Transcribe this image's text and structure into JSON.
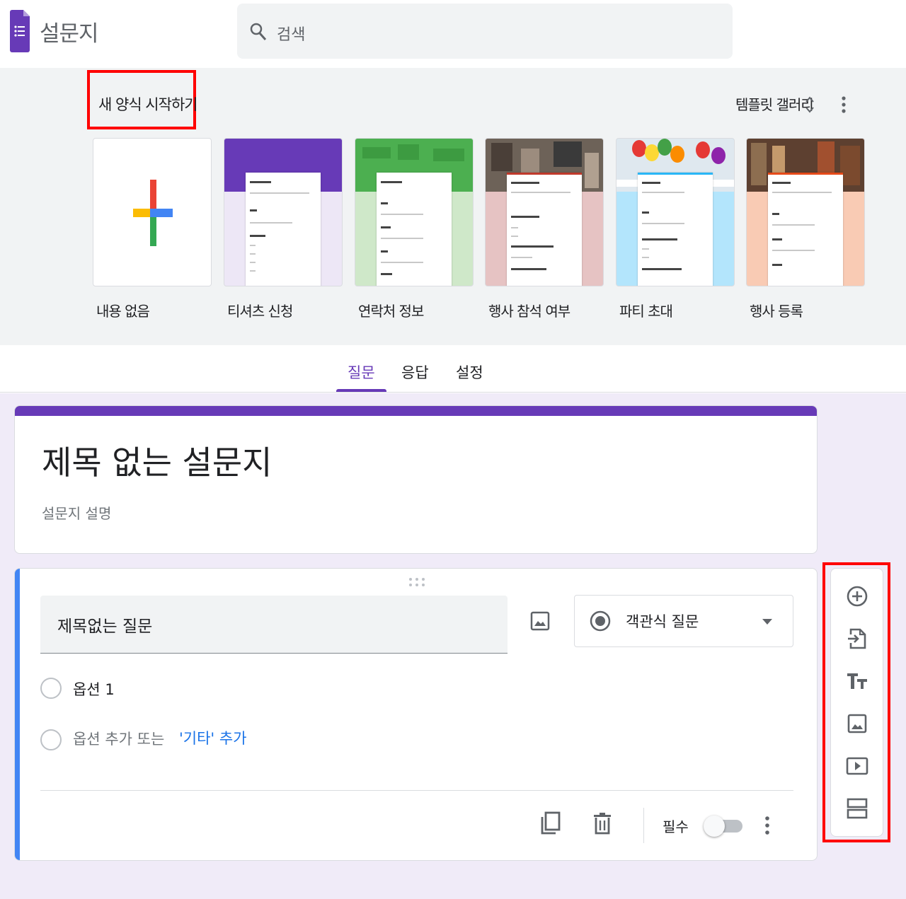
{
  "header": {
    "app_title": "설문지",
    "search_placeholder": "검색"
  },
  "gallery": {
    "start_title": "새 양식 시작하기",
    "gallery_label": "템플릿 갤러리",
    "templates": [
      {
        "label": "내용 없음"
      },
      {
        "label": "티셔츠 신청"
      },
      {
        "label": "연락처 정보"
      },
      {
        "label": "행사 참석 여부"
      },
      {
        "label": "파티 초대"
      },
      {
        "label": "행사 등록"
      }
    ]
  },
  "tabs": [
    {
      "label": "질문",
      "active": true
    },
    {
      "label": "응답",
      "active": false
    },
    {
      "label": "설정",
      "active": false
    }
  ],
  "form": {
    "title": "제목 없는 설문지",
    "description": "설문지 설명"
  },
  "question": {
    "title": "제목없는 질문",
    "type": "객관식 질문",
    "option1": "옵션 1",
    "add_option": "옵션 추가 또는",
    "add_other": "'기타' 추가",
    "required_label": "필수",
    "required": false
  },
  "toolbar_icons": [
    "add-question-icon",
    "import-questions-icon",
    "add-title-icon",
    "add-image-icon",
    "add-video-icon",
    "add-section-icon"
  ],
  "colors": {
    "accent": "#673ab7",
    "question_bar": "#4285f4",
    "link": "#1a73e8",
    "highlight": "#ff0000",
    "canvas": "#f0ebf8"
  }
}
